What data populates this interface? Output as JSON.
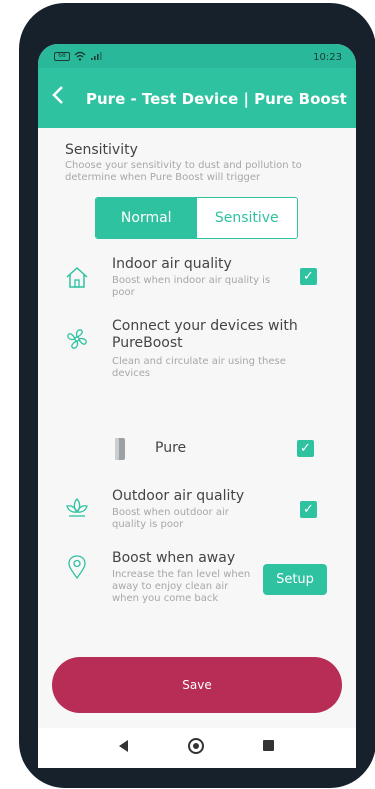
{
  "status_bar": {
    "battery": "68",
    "time": "10:23"
  },
  "app_bar": {
    "title": "Pure - Test Device | Pure Boost"
  },
  "sensitivity": {
    "title": "Sensitivity",
    "description": "Choose your sensitivity to dust and pollution to determine when Pure Boost will trigger",
    "options": [
      "Normal",
      "Sensitive"
    ],
    "selected": "Normal"
  },
  "indoor": {
    "title": "Indoor air quality",
    "description": "Boost when indoor air quality is poor",
    "checked": true
  },
  "connect": {
    "title": "Connect your devices with PureBoost",
    "description": "Clean and circulate air using these devices"
  },
  "device": {
    "name": "Pure",
    "checked": true
  },
  "outdoor": {
    "title": "Outdoor air quality",
    "description": "Boost when outdoor air quality is poor",
    "checked": true
  },
  "away": {
    "title": "Boost when away",
    "description": "Increase the fan level when away to enjoy clean air when you come back",
    "setup_label": "Setup"
  },
  "save_label": "Save",
  "colors": {
    "accent": "#2fc2a1",
    "save": "#b72d55"
  },
  "icons": [
    "battery-icon",
    "wifi-icon",
    "signal-icon",
    "back-arrow-icon",
    "house-icon",
    "fan-icon",
    "purifier-icon",
    "leaf-icon",
    "location-pin-icon",
    "check-icon"
  ]
}
